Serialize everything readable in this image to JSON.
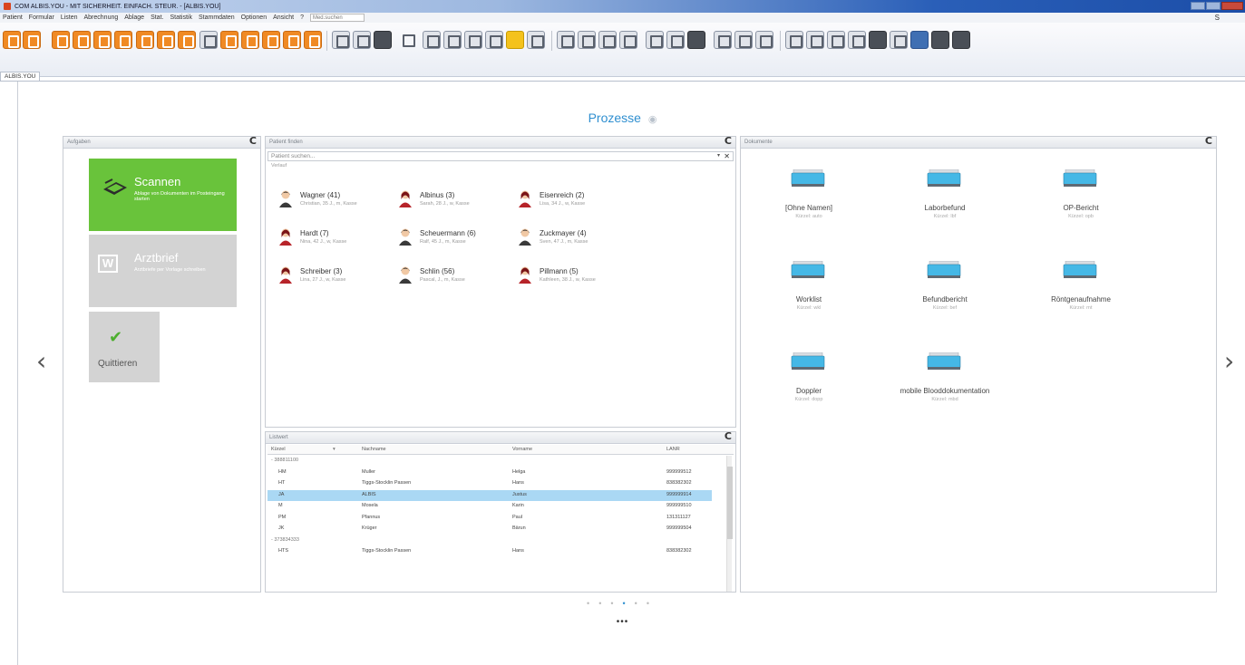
{
  "window": {
    "title": "COM ALBIS.YOU - MIT SICHERHEIT. EINFACH. STEUR. - [ALBIS.YOU]"
  },
  "menu": {
    "items": [
      "Patient",
      "Formular",
      "Listen",
      "Abrechnung",
      "Ablage",
      "Stat.",
      "Statistik",
      "Stammdaten",
      "Optionen",
      "Ansicht",
      "?"
    ],
    "search_placeholder": "Med.suchen",
    "help_glyph": "S"
  },
  "docs_tab": {
    "label": "ALBIS.YOU"
  },
  "page": {
    "title": "Prozesse",
    "prev_arrow": "‹",
    "next_arrow": "›"
  },
  "panels": {
    "aufgaben": {
      "title": "Aufgaben"
    },
    "patient": {
      "title": "Patient finden"
    },
    "liste": {
      "title": "Listwert"
    },
    "dokumente": {
      "title": "Dokumente"
    },
    "refresh_glyph": "C"
  },
  "tiles": {
    "scannen": {
      "title": "Scannen",
      "subtitle": "Ablage von Dokumenten im Posteingang starten"
    },
    "arztbrief": {
      "title": "Arztbrief",
      "subtitle": "Arztbriefe per Vorlage schreiben"
    },
    "quittieren": {
      "title": "Quittieren",
      "check": "✔"
    }
  },
  "patient_search": {
    "placeholder": "Patient suchen...",
    "section_label": "Verlauf",
    "dropdown_glyph": "▾",
    "clear_glyph": "✕",
    "patients": [
      {
        "name": "Wagner (41)",
        "info": "Christian, 35 J., m, Kasse",
        "gender": "m"
      },
      {
        "name": "Albinus (3)",
        "info": "Sarah, 28 J., w, Kasse",
        "gender": "f"
      },
      {
        "name": "Eisenreich (2)",
        "info": "Lisa, 34 J., w, Kasse",
        "gender": "f"
      },
      {
        "name": "Hardt (7)",
        "info": "Nina, 42 J., w, Kasse",
        "gender": "f"
      },
      {
        "name": "Scheuermann (6)",
        "info": "Ralf, 45 J., m, Kasse",
        "gender": "m"
      },
      {
        "name": "Zuckmayer (4)",
        "info": "Sven, 47 J., m, Kasse",
        "gender": "m"
      },
      {
        "name": "Schreiber (3)",
        "info": "Lina, 27 J., w, Kasse",
        "gender": "f"
      },
      {
        "name": "Schlin (56)",
        "info": "Pascal, J., m, Kasse",
        "gender": "m"
      },
      {
        "name": "Pillmann (5)",
        "info": "Kathleen, 38 J., w, Kasse",
        "gender": "f"
      }
    ]
  },
  "list": {
    "columns": [
      "Kürzel",
      "Nachname",
      "Vorname",
      "LANR"
    ],
    "rows": [
      {
        "type": "group",
        "label": "- 388811100"
      },
      {
        "type": "row",
        "cells": [
          "HM",
          "Muller",
          "Helga",
          "999999512"
        ]
      },
      {
        "type": "row",
        "cells": [
          "HT",
          "Tiggs-Stocklin Passen",
          "Hans",
          "838382302"
        ]
      },
      {
        "type": "row",
        "selected": true,
        "cells": [
          "JA",
          "ALBIS",
          "Justus",
          "999999914"
        ]
      },
      {
        "type": "row",
        "cells": [
          "M",
          "Mosela",
          "Karin",
          "999999510"
        ]
      },
      {
        "type": "row",
        "cells": [
          "PM",
          "Pfannus",
          "Paul",
          "131311127"
        ]
      },
      {
        "type": "row",
        "cells": [
          "JK",
          "Krüger",
          "Bärun",
          "999999504"
        ]
      },
      {
        "type": "group",
        "label": "- 373834333"
      },
      {
        "type": "row",
        "cells": [
          "HTS",
          "Tiggs-Stocklin Passen",
          "Hans",
          "838382302"
        ]
      }
    ]
  },
  "doc_types": [
    {
      "name": "[Ohne Namen]",
      "sub": "Kürzel: auto"
    },
    {
      "name": "Laborbefund",
      "sub": "Kürzel: lbf"
    },
    {
      "name": "OP-Bericht",
      "sub": "Kürzel: opb"
    },
    {
      "name": "Worklist",
      "sub": "Kürzel: wkl"
    },
    {
      "name": "Befundbericht",
      "sub": "Kürzel: bef"
    },
    {
      "name": "Röntgenaufnahme",
      "sub": "Kürzel: rnt"
    },
    {
      "name": "Doppler",
      "sub": "Kürzel: dopp"
    },
    {
      "name": "mobile Blooddokumentation",
      "sub": "Kürzel: mbd"
    }
  ],
  "pager": {
    "dots": [
      "•",
      "•",
      "•",
      "•",
      "•",
      "•"
    ],
    "active_index": 3,
    "more": "•••"
  },
  "colors": {
    "accent": "#2f8fd0",
    "tile_green": "#69c33b",
    "tile_gray": "#d3d3d3",
    "selected_row": "#aad8f4",
    "toolbar_orange": "#f08a24"
  }
}
